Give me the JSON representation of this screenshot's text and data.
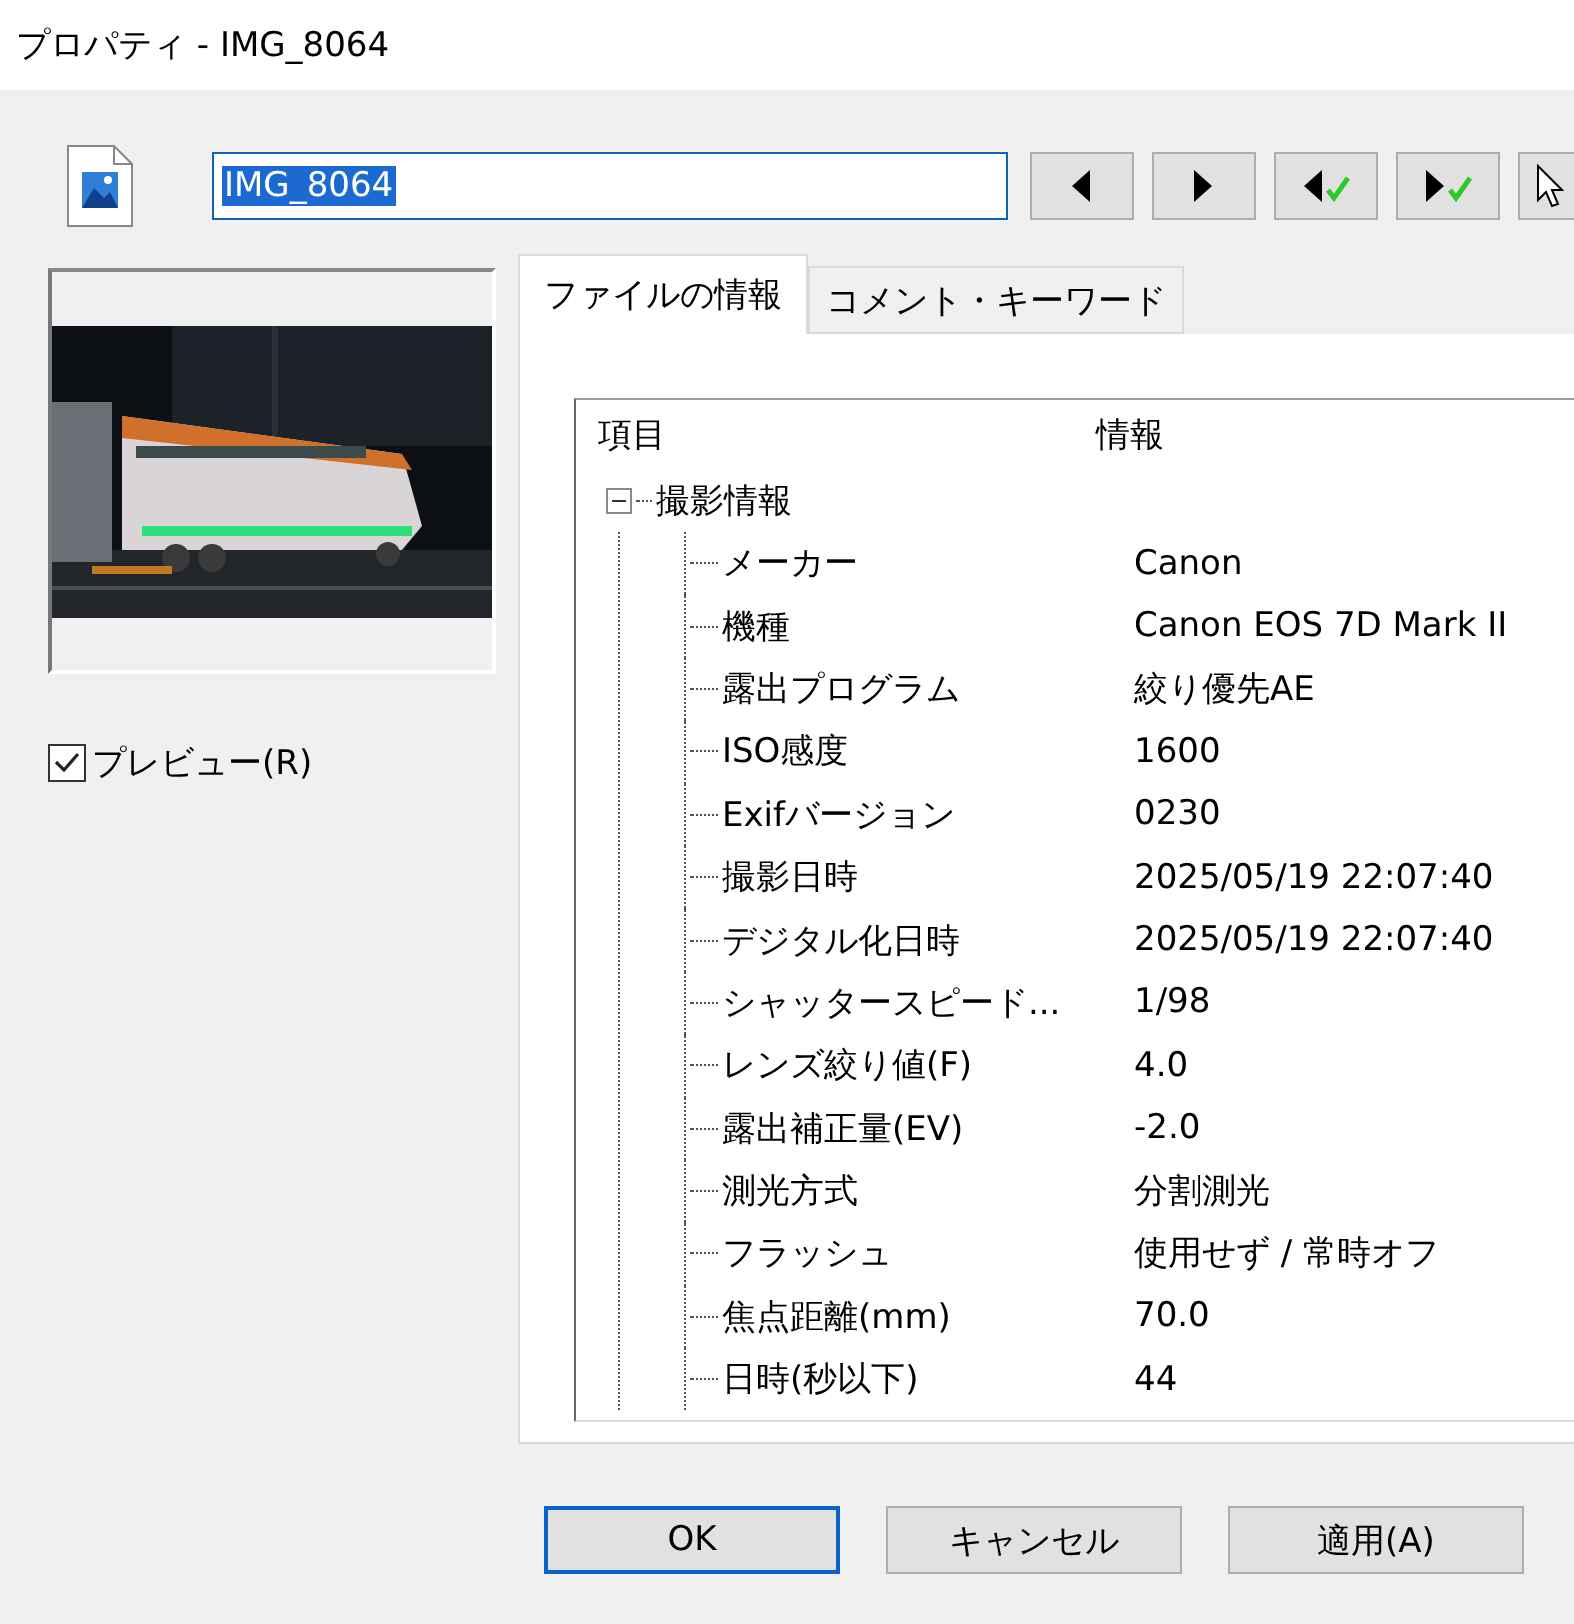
{
  "window": {
    "title": "プロパティ - IMG_8064"
  },
  "file_name": {
    "value": "IMG_8064",
    "selected": true
  },
  "nav_buttons": [
    {
      "kind": "prev"
    },
    {
      "kind": "next"
    },
    {
      "kind": "prev-check"
    },
    {
      "kind": "next-check"
    },
    {
      "kind": "pointer"
    }
  ],
  "preview_checkbox": {
    "label": "プレビュー(R)",
    "checked": true
  },
  "tabs": [
    {
      "label": "ファイルの情報",
      "selected": true
    },
    {
      "label": "コメント・キーワード",
      "selected": false
    }
  ],
  "tree": {
    "columns": [
      "項目",
      "情報"
    ],
    "items": [
      {
        "label": "撮影情報",
        "expanded": true,
        "children": [
          {
            "label": "メーカー",
            "value": "Canon"
          },
          {
            "label": "機種",
            "value": "Canon EOS 7D Mark II"
          },
          {
            "label": "露出プログラム",
            "value": "絞り優先AE"
          },
          {
            "label": "ISO感度",
            "value": "1600"
          },
          {
            "label": "Exifバージョン",
            "value": "0230"
          },
          {
            "label": "撮影日時",
            "value": "2025/05/19 22:07:40"
          },
          {
            "label": "デジタル化日時",
            "value": "2025/05/19 22:07:40"
          },
          {
            "label": "シャッタースピード...",
            "value": "1/98"
          },
          {
            "label": "レンズ絞り値(F)",
            "value": "4.0"
          },
          {
            "label": "露出補正量(EV)",
            "value": "-2.0"
          },
          {
            "label": "測光方式",
            "value": "分割測光"
          },
          {
            "label": "フラッシュ",
            "value": "使用せず / 常時オフ"
          },
          {
            "label": "焦点距離(mm)",
            "value": "70.0"
          },
          {
            "label": "日時(秒以下)",
            "value": "44"
          }
        ]
      }
    ]
  },
  "buttons": [
    {
      "label": "OK",
      "default": true
    },
    {
      "label": "キャンセル",
      "default": false
    },
    {
      "label": "適用(A)",
      "default": false
    }
  ]
}
